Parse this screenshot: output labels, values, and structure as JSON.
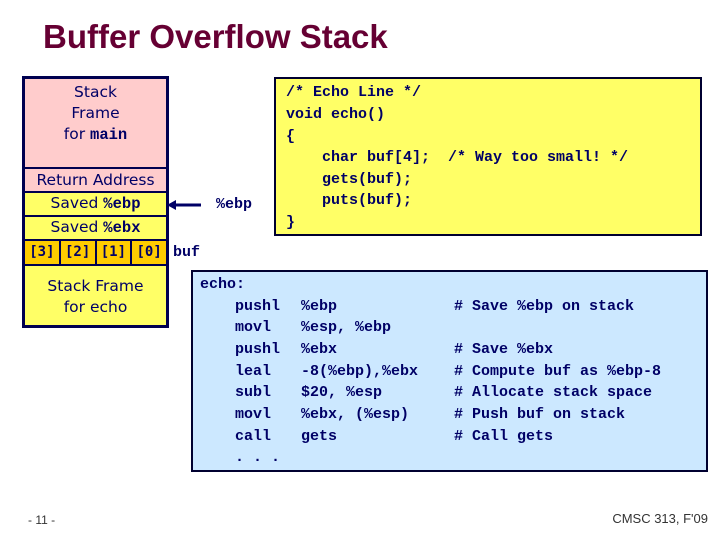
{
  "slide": {
    "title": "Buffer Overflow Stack",
    "page_number": "- 11 -",
    "course": "CMSC 313, F'09"
  },
  "stack": {
    "main_frame": [
      "Stack",
      "Frame",
      "for "
    ],
    "main_frame_code": "main",
    "return_address": "Return Address",
    "saved_ebp_prefix": "Saved ",
    "saved_ebp_reg": "%ebp",
    "saved_ebx_prefix": "Saved ",
    "saved_ebx_reg": "%ebx",
    "buf_cells": [
      "[3]",
      "[2]",
      "[1]",
      "[0]"
    ],
    "echo_frame_line1": "Stack Frame",
    "echo_frame_line2_prefix": "for ",
    "echo_frame_code": "echo",
    "ebp_pointer_label": "%ebp",
    "buf_label": "buf",
    "colors": {
      "caller_frame": "#ffcccc",
      "saved_regs": "#ffff66",
      "buffer": "#ffcc00",
      "border": "#000050"
    }
  },
  "c_code": {
    "lines": [
      "/* Echo Line */",
      "void echo()",
      "{",
      "    char buf[4];  /* Way too small! */",
      "    gets(buf);",
      "    puts(buf);",
      "}"
    ]
  },
  "assembly": {
    "label": "echo:",
    "instructions": [
      {
        "op": "pushl",
        "args": "%ebp",
        "comment": "# Save %ebp on stack"
      },
      {
        "op": "movl",
        "args": "%esp, %ebp",
        "comment": ""
      },
      {
        "op": "pushl",
        "args": "%ebx",
        "comment": "# Save %ebx"
      },
      {
        "op": "leal",
        "args": "-8(%ebp),%ebx",
        "comment": "# Compute buf as %ebp-8"
      },
      {
        "op": "subl",
        "args": "$20, %esp",
        "comment": "# Allocate stack space"
      },
      {
        "op": "movl",
        "args": "%ebx, (%esp)",
        "comment": "# Push buf on stack"
      },
      {
        "op": "call",
        "args": "gets",
        "comment": "# Call gets"
      }
    ],
    "ellipsis": ". . ."
  }
}
